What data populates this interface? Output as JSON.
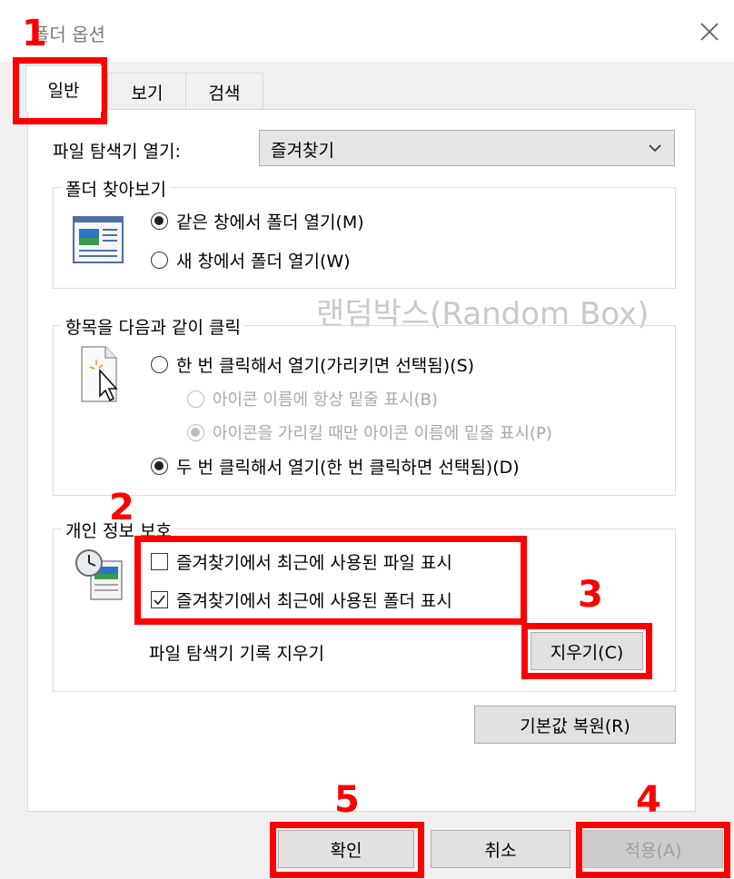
{
  "window": {
    "title": "폴더 옵션"
  },
  "tabs": [
    {
      "label": "일반"
    },
    {
      "label": "보기"
    },
    {
      "label": "검색"
    }
  ],
  "browse": {
    "label": "파일 탐색기 열기:",
    "selected": "즐겨찾기"
  },
  "browse_folders": {
    "title": "폴더 찾아보기",
    "options": [
      {
        "label": "같은 창에서 폴더 열기(M)",
        "checked": true
      },
      {
        "label": "새 창에서 폴더 열기(W)",
        "checked": false
      }
    ]
  },
  "click_items": {
    "title": "항목을 다음과 같이 클릭",
    "options": [
      {
        "label": "한 번 클릭해서 열기(가리키면 선택됨)(S)",
        "checked": false
      },
      {
        "label": "아이콘 이름에 항상 밑줄 표시(B)",
        "checked": false,
        "disabled": true
      },
      {
        "label": "아이콘을 가리킬 때만 아이콘 이름에 밑줄 표시(P)",
        "checked": true,
        "disabled": true
      },
      {
        "label": "두 번 클릭해서 열기(한 번 클릭하면 선택됨)(D)",
        "checked": true
      }
    ]
  },
  "privacy": {
    "title": "개인 정보 보호",
    "checkboxes": [
      {
        "label": "즐겨찾기에서 최근에 사용된 파일 표시",
        "checked": false
      },
      {
        "label": "즐겨찾기에서 최근에 사용된 폴더 표시",
        "checked": true
      }
    ],
    "clear_label": "파일 탐색기 기록 지우기",
    "clear_button": "지우기(C)"
  },
  "restore_button": "기본값 복원(R)",
  "footer": {
    "ok": "확인",
    "cancel": "취소",
    "apply": "적용(A)"
  },
  "watermark": "랜덤박스(Random Box)",
  "annotations": [
    "1",
    "2",
    "3",
    "4",
    "5"
  ],
  "colors": {
    "annotation": "#ff0000",
    "panel": "#ffffff",
    "window": "#f0f0f0"
  }
}
